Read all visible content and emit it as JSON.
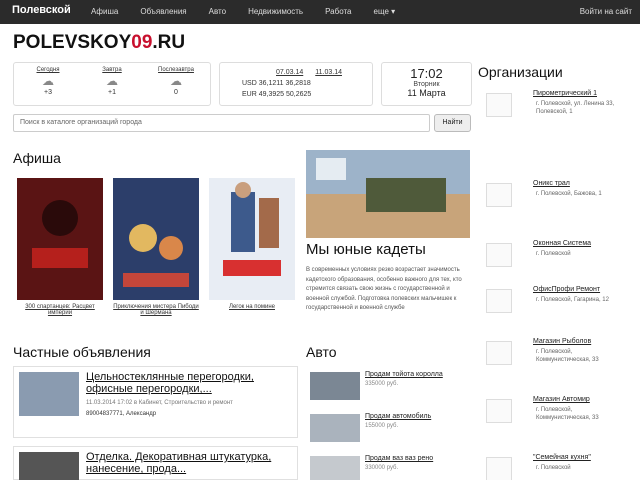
{
  "topbar": {
    "brand": "Полевской",
    "nav": [
      "Афиша",
      "Объявления",
      "Авто",
      "Недвижимость",
      "Работа",
      "еще ▾"
    ],
    "login": "Войти на сайт"
  },
  "logo": {
    "main": "POLEVSKOY",
    "accent": "09",
    "suffix": ".RU"
  },
  "weather": [
    {
      "label": "Сегодня",
      "value": "+3"
    },
    {
      "label": "Завтра",
      "value": "+1"
    },
    {
      "label": "Послезавтра",
      "value": "0"
    }
  ],
  "rates": {
    "dates": [
      "07.03.14",
      "11.03.14"
    ],
    "usd": "USD 36,1211  36,2818",
    "eur": "EUR 49,3925  50,2625"
  },
  "clock": {
    "time": "17:02",
    "weekday": "Вторник",
    "date": "11 Марта"
  },
  "search": {
    "placeholder": "Поиск в каталоге организаций города",
    "button": "Найти"
  },
  "sections": {
    "afisha": "Афиша",
    "ads": "Частные объявления",
    "auto": "Авто",
    "orgs": "Организации"
  },
  "posters": [
    {
      "caption": "300 спартанцев: Расцвет империи",
      "color": "#6b1d1d"
    },
    {
      "caption": "Приключения мистера Пибоди и Шермана",
      "color": "#3b2a58"
    },
    {
      "caption": "Легок на помине",
      "color": "#dfe6f0"
    }
  ],
  "news": {
    "title": "Мы юные кадеты",
    "text": "В современных условиях резко возрастает значимость кадетского образования, особенно важного для тех, кто стремится связать свою жизнь с государственной и военной службой. Подготовка полевских мальчишек к государственной и военной службе"
  },
  "ads": [
    {
      "title": "Цельностеклянные перегородки, офисные перегородки,...",
      "meta": "11.03.2014 17:02 в Кабинет, Строительство и ремонт",
      "price": "89004837771, Александр"
    },
    {
      "title": "Отделка. Декоративная штукатурка, нанесение, прода...",
      "meta": "",
      "price": ""
    }
  ],
  "cars": [
    {
      "title": "Продам тойота королла",
      "price": "335000 руб."
    },
    {
      "title": "Продам автомобиль",
      "price": "155000 руб."
    },
    {
      "title": "Продам ваз ваз рено",
      "price": "330000 руб."
    }
  ],
  "orgs": [
    {
      "name": "Пирометрический 1",
      "addr": "г. Полевской, ул. Ленина 33, Полевской, 1"
    },
    {
      "name": "Оникс трал",
      "addr": "г. Полевской, Бажова, 1"
    },
    {
      "name": "Оконная Система",
      "addr": "г. Полевской"
    },
    {
      "name": "ОфисПрофи Ремонт",
      "addr": "г. Полевской, Гагарина, 12"
    },
    {
      "name": "Магазин Рыболов",
      "addr": "г. Полевской, Коммунистическая, 33"
    },
    {
      "name": "Магазин Автомир",
      "addr": "г. Полевской, Коммунистическая, 33"
    },
    {
      "name": "\"Семейная кухня\"",
      "addr": "г. Полевской"
    }
  ]
}
